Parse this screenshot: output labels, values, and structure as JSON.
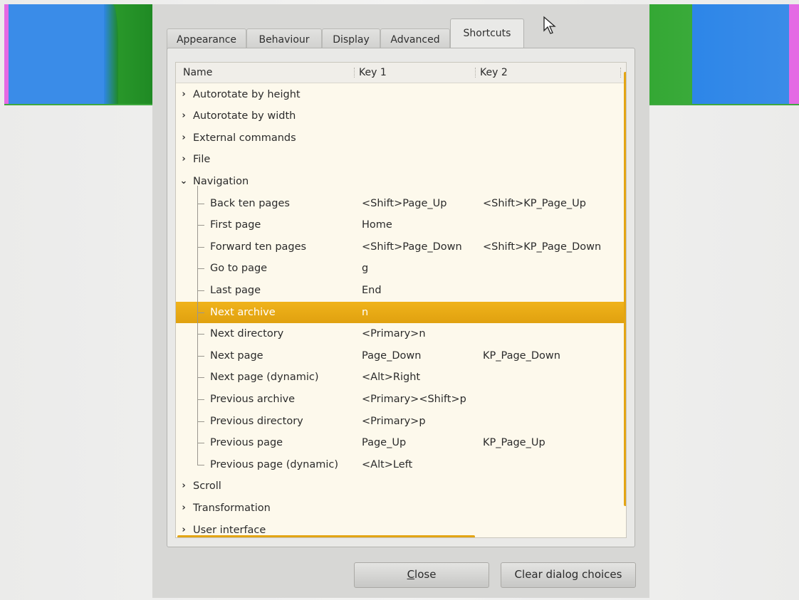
{
  "tabs": [
    {
      "label": "Appearance"
    },
    {
      "label": "Behaviour"
    },
    {
      "label": "Display"
    },
    {
      "label": "Advanced"
    },
    {
      "label": "Shortcuts",
      "active": true
    }
  ],
  "table": {
    "columns": [
      "Name",
      "Key 1",
      "Key 2"
    ],
    "rows": [
      {
        "name": "Autorotate by height",
        "key1": "",
        "key2": "",
        "level": 0,
        "expander": "›"
      },
      {
        "name": "Autorotate by width",
        "key1": "",
        "key2": "",
        "level": 0,
        "expander": "›"
      },
      {
        "name": "External commands",
        "key1": "",
        "key2": "",
        "level": 0,
        "expander": "›"
      },
      {
        "name": "File",
        "key1": "",
        "key2": "",
        "level": 0,
        "expander": "›"
      },
      {
        "name": "Navigation",
        "key1": "",
        "key2": "",
        "level": 0,
        "expander": "⌄"
      },
      {
        "name": "Back ten pages",
        "key1": "<Shift>Page_Up",
        "key2": "<Shift>KP_Page_Up",
        "level": 1
      },
      {
        "name": "First page",
        "key1": "Home",
        "key2": "",
        "level": 1
      },
      {
        "name": "Forward ten pages",
        "key1": "<Shift>Page_Down",
        "key2": "<Shift>KP_Page_Down",
        "level": 1
      },
      {
        "name": "Go to page",
        "key1": "g",
        "key2": "",
        "level": 1
      },
      {
        "name": "Last page",
        "key1": "End",
        "key2": "",
        "level": 1
      },
      {
        "name": "Next archive",
        "key1": "n",
        "key2": "",
        "level": 1,
        "selected": true
      },
      {
        "name": "Next directory",
        "key1": "<Primary>n",
        "key2": "",
        "level": 1
      },
      {
        "name": "Next page",
        "key1": "Page_Down",
        "key2": "KP_Page_Down",
        "level": 1
      },
      {
        "name": "Next page (dynamic)",
        "key1": "<Alt>Right",
        "key2": "",
        "level": 1
      },
      {
        "name": "Previous archive",
        "key1": "<Primary><Shift>p",
        "key2": "",
        "level": 1
      },
      {
        "name": "Previous directory",
        "key1": "<Primary>p",
        "key2": "",
        "level": 1
      },
      {
        "name": "Previous page",
        "key1": "Page_Up",
        "key2": "KP_Page_Up",
        "level": 1
      },
      {
        "name": "Previous page (dynamic)",
        "key1": "<Alt>Left",
        "key2": "",
        "level": 1,
        "last": true
      },
      {
        "name": "Scroll",
        "key1": "",
        "key2": "",
        "level": 0,
        "expander": "›"
      },
      {
        "name": "Transformation",
        "key1": "",
        "key2": "",
        "level": 0,
        "expander": "›"
      },
      {
        "name": "User interface",
        "key1": "",
        "key2": "",
        "level": 0,
        "expander": "›"
      }
    ]
  },
  "buttons": {
    "close_label": "Close",
    "close_mnemonic": "C",
    "close_rest": "lose",
    "clear_label": "Clear dialog choices"
  },
  "colors": {
    "selection": "#e6a514",
    "tree_background": "#fdf9ec"
  }
}
